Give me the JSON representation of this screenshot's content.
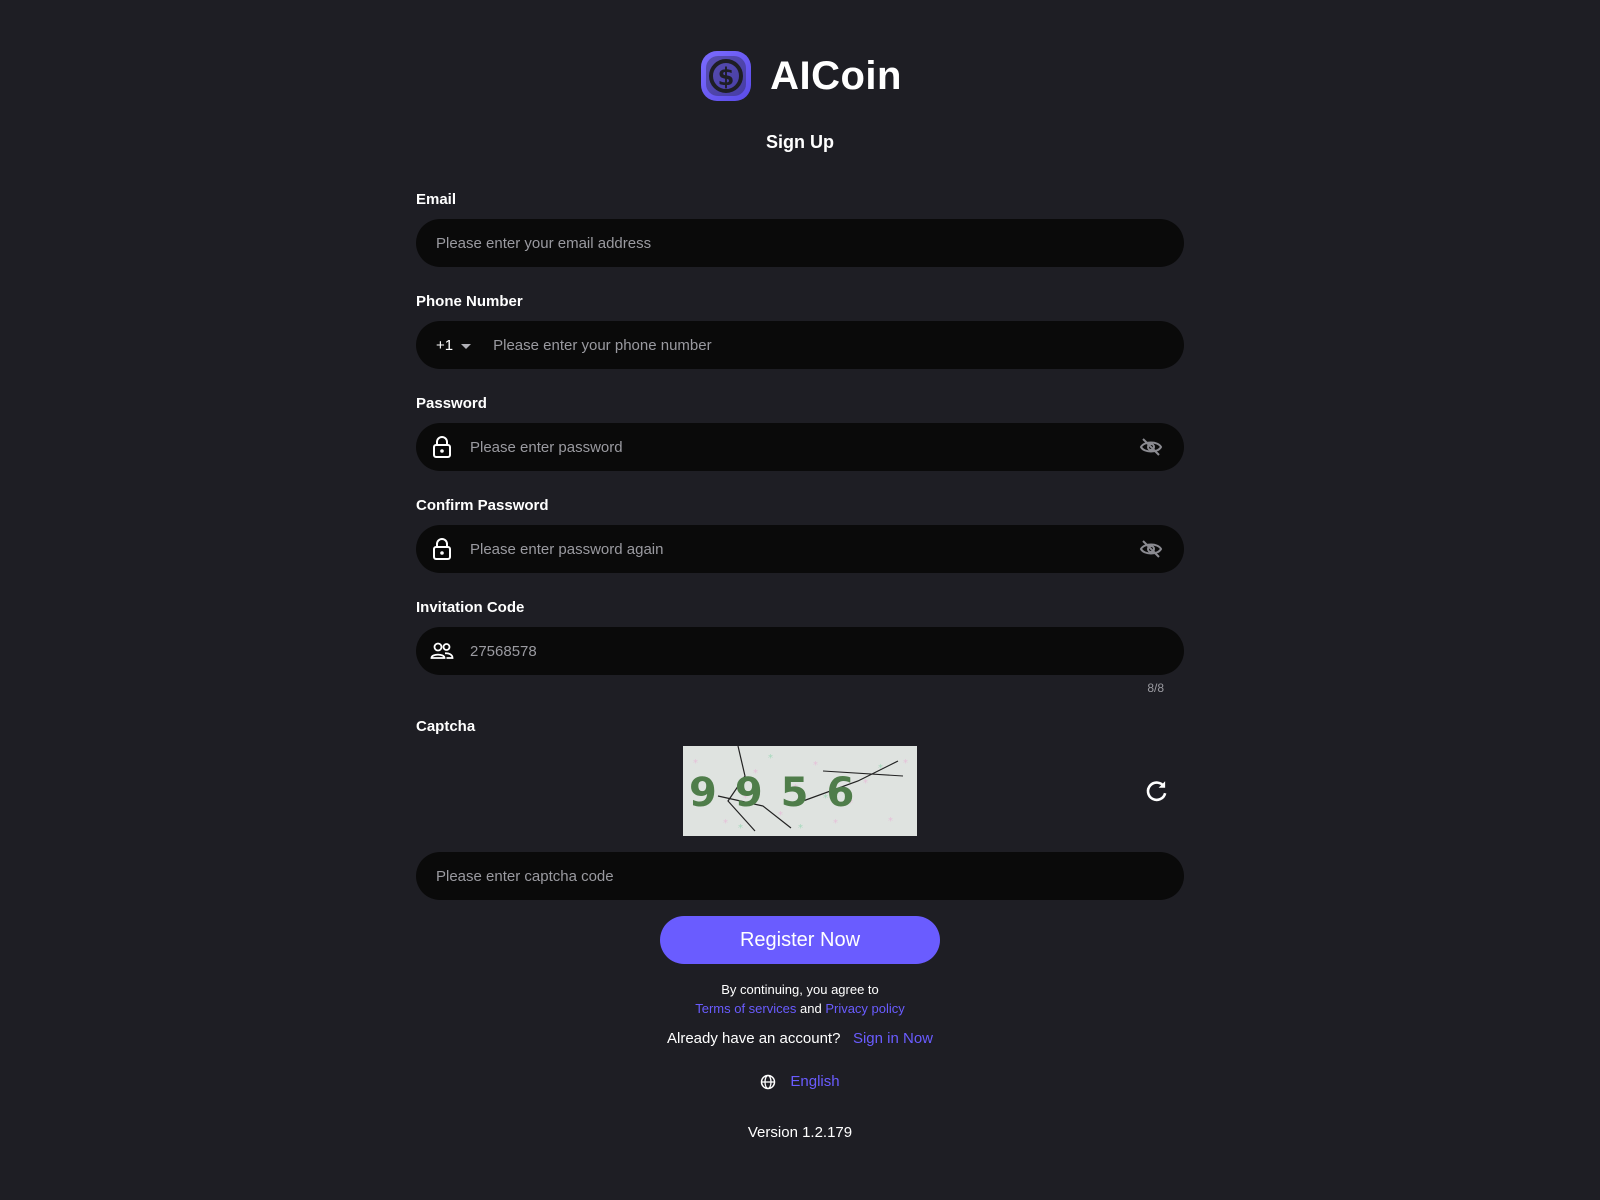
{
  "brand": {
    "name": "AICoin",
    "accent_color": "#6a5cff"
  },
  "page": {
    "title": "Sign Up"
  },
  "form": {
    "email": {
      "label": "Email",
      "placeholder": "Please enter your email address",
      "value": ""
    },
    "phone": {
      "label": "Phone Number",
      "country_code": "+1",
      "placeholder": "Please enter your phone number",
      "value": ""
    },
    "password": {
      "label": "Password",
      "placeholder": "Please enter password",
      "value": "",
      "prefix_icon": "lock-icon",
      "suffix_icon": "eye-off-icon"
    },
    "confirm_password": {
      "label": "Confirm Password",
      "placeholder": "Please enter password again",
      "value": "",
      "prefix_icon": "lock-icon",
      "suffix_icon": "eye-off-icon"
    },
    "invitation": {
      "label": "Invitation Code",
      "placeholder": "27568578",
      "value": "",
      "counter": "8/8",
      "prefix_icon": "users-icon"
    },
    "captcha": {
      "label": "Captcha",
      "image_text": "9956",
      "placeholder": "Please enter captcha code",
      "value": "",
      "refresh_icon": "refresh-icon"
    }
  },
  "actions": {
    "register_label": "Register Now"
  },
  "legal": {
    "agree_text": "By continuing, you agree to",
    "terms_label": "Terms of services",
    "and_text": "and",
    "privacy_label": "Privacy policy"
  },
  "signin": {
    "prompt": "Already have an account?",
    "link_label": "Sign in Now"
  },
  "language": {
    "icon": "globe-icon",
    "selected": "English"
  },
  "footer": {
    "version": "Version 1.2.179"
  }
}
